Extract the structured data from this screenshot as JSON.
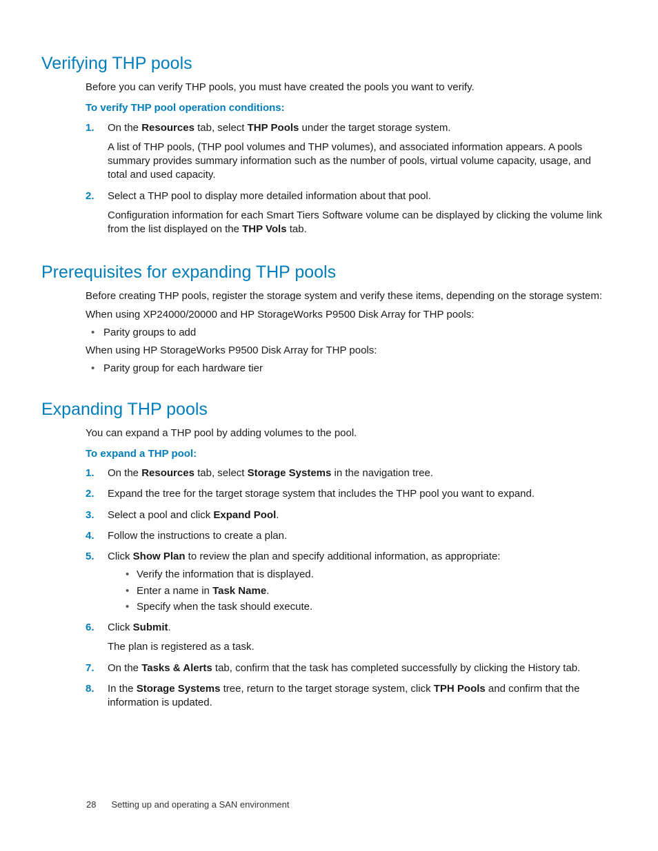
{
  "section1": {
    "title": "Verifying THP pools",
    "intro": "Before you can verify THP pools, you must have created the pools you want to verify.",
    "subhead": "To verify THP pool operation conditions:",
    "step1_a": "On the ",
    "step1_b": "Resources",
    "step1_c": " tab, select ",
    "step1_d": "THP Pools",
    "step1_e": " under the target storage system.",
    "step1_body": "A list of THP pools, (THP pool volumes and THP volumes), and associated information appears. A pools summary provides summary information such as the number of pools, virtual volume capacity, usage, and total and used capacity.",
    "step2_a": "Select a THP pool to display more detailed information about that pool.",
    "step2_body_a": "Configuration information for each Smart Tiers Software volume can be displayed by clicking the volume link from the list displayed on the ",
    "step2_body_b": "THP Vols",
    "step2_body_c": " tab."
  },
  "section2": {
    "title": "Prerequisites for expanding THP pools",
    "p1": "Before creating THP pools, register the storage system and verify these items, depending on the storage system:",
    "p2": "When using XP24000/20000 and HP StorageWorks P9500 Disk Array for THP pools:",
    "b1": "Parity groups to add",
    "p3": "When using HP StorageWorks P9500 Disk Array for THP pools:",
    "b2": "Parity group for each hardware tier"
  },
  "section3": {
    "title": "Expanding THP pools",
    "intro": "You can expand a THP pool by adding volumes to the pool.",
    "subhead": "To expand a THP pool:",
    "s1_a": "On the ",
    "s1_b": "Resources",
    "s1_c": " tab, select ",
    "s1_d": "Storage Systems",
    "s1_e": " in the navigation tree.",
    "s2": "Expand the tree for the target storage system that includes the THP pool you want to expand.",
    "s3_a": "Select a pool and click ",
    "s3_b": "Expand Pool",
    "s3_c": ".",
    "s4": "Follow the instructions to create a plan.",
    "s5_a": "Click ",
    "s5_b": "Show Plan",
    "s5_c": " to review the plan and specify additional information, as appropriate:",
    "s5_sub1": "Verify the information that is displayed.",
    "s5_sub2_a": "Enter a name in ",
    "s5_sub2_b": "Task Name",
    "s5_sub2_c": ".",
    "s5_sub3": "Specify when the task should execute.",
    "s6_a": "Click ",
    "s6_b": "Submit",
    "s6_c": ".",
    "s6_body": "The plan is registered as a task.",
    "s7_a": "On the ",
    "s7_b": "Tasks & Alerts",
    "s7_c": " tab, confirm that the task has completed successfully by clicking the History tab.",
    "s8_a": "In the ",
    "s8_b": "Storage Systems",
    "s8_c": " tree, return to the target storage system, click ",
    "s8_d": "TPH Pools",
    "s8_e": " and confirm that the information is updated."
  },
  "footer": {
    "pageno": "28",
    "chapter": "Setting up and operating a SAN environment"
  }
}
